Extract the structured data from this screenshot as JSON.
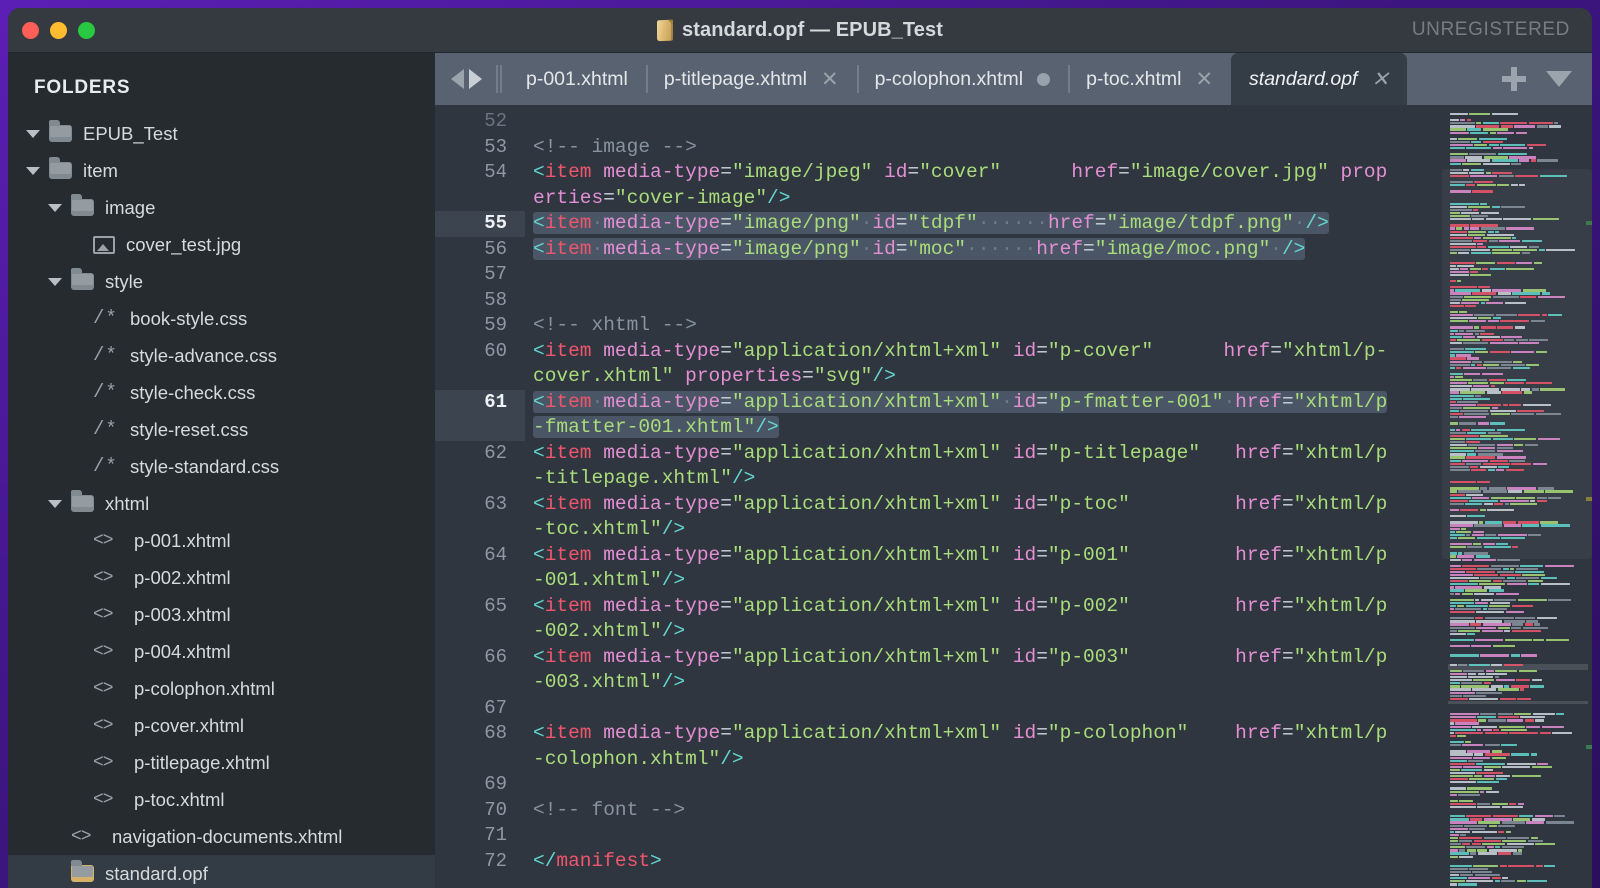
{
  "window": {
    "title": "standard.opf — EPUB_Test",
    "license_status": "UNREGISTERED",
    "doc_icon": "opf-file-icon"
  },
  "traffic_lights": [
    {
      "name": "close",
      "color": "#ff5f57"
    },
    {
      "name": "minimize",
      "color": "#febc2e"
    },
    {
      "name": "zoom",
      "color": "#28c840"
    }
  ],
  "sidebar": {
    "heading": "FOLDERS",
    "tree": [
      {
        "label": "EPUB_Test",
        "icon": "folder-icon",
        "indent": 0,
        "twisty": "open",
        "selected": false
      },
      {
        "label": "item",
        "icon": "folder-icon",
        "indent": 1,
        "twisty": "open",
        "selected": false
      },
      {
        "label": "image",
        "icon": "folder-icon",
        "indent": 2,
        "twisty": "open",
        "selected": false
      },
      {
        "label": "cover_test.jpg",
        "icon": "image-file-icon",
        "indent": 3,
        "twisty": "none",
        "selected": false
      },
      {
        "label": "style",
        "icon": "folder-icon",
        "indent": 2,
        "twisty": "open",
        "selected": false
      },
      {
        "label": "book-style.css",
        "icon": "css-file-icon",
        "indent": 3,
        "twisty": "none",
        "selected": false
      },
      {
        "label": "style-advance.css",
        "icon": "css-file-icon",
        "indent": 3,
        "twisty": "none",
        "selected": false
      },
      {
        "label": "style-check.css",
        "icon": "css-file-icon",
        "indent": 3,
        "twisty": "none",
        "selected": false
      },
      {
        "label": "style-reset.css",
        "icon": "css-file-icon",
        "indent": 3,
        "twisty": "none",
        "selected": false
      },
      {
        "label": "style-standard.css",
        "icon": "css-file-icon",
        "indent": 3,
        "twisty": "none",
        "selected": false
      },
      {
        "label": "xhtml",
        "icon": "folder-icon",
        "indent": 2,
        "twisty": "open",
        "selected": false
      },
      {
        "label": "p-001.xhtml",
        "icon": "code-file-icon",
        "indent": 3,
        "twisty": "none",
        "selected": false
      },
      {
        "label": "p-002.xhtml",
        "icon": "code-file-icon",
        "indent": 3,
        "twisty": "none",
        "selected": false
      },
      {
        "label": "p-003.xhtml",
        "icon": "code-file-icon",
        "indent": 3,
        "twisty": "none",
        "selected": false
      },
      {
        "label": "p-004.xhtml",
        "icon": "code-file-icon",
        "indent": 3,
        "twisty": "none",
        "selected": false
      },
      {
        "label": "p-colophon.xhtml",
        "icon": "code-file-icon",
        "indent": 3,
        "twisty": "none",
        "selected": false
      },
      {
        "label": "p-cover.xhtml",
        "icon": "code-file-icon",
        "indent": 3,
        "twisty": "none",
        "selected": false
      },
      {
        "label": "p-titlepage.xhtml",
        "icon": "code-file-icon",
        "indent": 3,
        "twisty": "none",
        "selected": false
      },
      {
        "label": "p-toc.xhtml",
        "icon": "code-file-icon",
        "indent": 3,
        "twisty": "none",
        "selected": false
      },
      {
        "label": "navigation-documents.xhtml",
        "icon": "code-file-icon",
        "indent": 2,
        "twisty": "none",
        "selected": false
      },
      {
        "label": "standard.opf",
        "icon": "opf-file-icon",
        "indent": 2,
        "twisty": "none",
        "selected": true
      }
    ]
  },
  "tabbar": {
    "nav_back": "nav-back-arrow",
    "nav_forward": "nav-forward-arrow",
    "new_tab_label": "+",
    "tab_menu_label": "▼",
    "tabs": [
      {
        "label": "p-001.xhtml",
        "active": false,
        "state": "none",
        "close": ""
      },
      {
        "label": "p-titlepage.xhtml",
        "active": false,
        "state": "close",
        "close": "✕"
      },
      {
        "label": "p-colophon.xhtml",
        "active": false,
        "state": "dirty",
        "close": ""
      },
      {
        "label": "p-toc.xhtml",
        "active": false,
        "state": "close",
        "close": "✕"
      },
      {
        "label": "standard.opf",
        "active": true,
        "state": "close",
        "close": "✕"
      }
    ]
  },
  "editor": {
    "first_visible_line": 52,
    "selected_lines": [
      55,
      56,
      61
    ],
    "caret_lines": [
      55,
      61
    ],
    "syntax_colors": {
      "bracket": "#63d6cf",
      "tag_name": "#f0556c",
      "attribute": "#e48fd4",
      "string": "#a9dc7a",
      "comment": "#8893a0",
      "foreground": "#cfd6de",
      "background": "#2f3640",
      "selection": "#4a5665",
      "gutter_text": "#8e98a4"
    },
    "lines": [
      {
        "n": 52,
        "text": "",
        "clipped": true
      },
      {
        "n": 53,
        "text": "<!-- image -->"
      },
      {
        "n": 54,
        "text": "<item media-type=\"image/jpeg\" id=\"cover\"      href=\"image/cover.jpg\" properties=\"cover-image\"/>"
      },
      {
        "n": 55,
        "text": "<item media-type=\"image/png\" id=\"tdpf\"      href=\"image/tdpf.png\" />"
      },
      {
        "n": 56,
        "text": "<item media-type=\"image/png\" id=\"moc\"      href=\"image/moc.png\" />"
      },
      {
        "n": 57,
        "text": ""
      },
      {
        "n": 58,
        "text": ""
      },
      {
        "n": 59,
        "text": "<!-- xhtml -->"
      },
      {
        "n": 60,
        "text": "<item media-type=\"application/xhtml+xml\" id=\"p-cover\"      href=\"xhtml/p-cover.xhtml\" properties=\"svg\"/>"
      },
      {
        "n": 61,
        "text": "<item media-type=\"application/xhtml+xml\" id=\"p-fmatter-001\" href=\"xhtml/p-fmatter-001.xhtml\"/>"
      },
      {
        "n": 62,
        "text": "<item media-type=\"application/xhtml+xml\" id=\"p-titlepage\"   href=\"xhtml/p-titlepage.xhtml\"/>"
      },
      {
        "n": 63,
        "text": "<item media-type=\"application/xhtml+xml\" id=\"p-toc\"         href=\"xhtml/p-toc.xhtml\"/>"
      },
      {
        "n": 64,
        "text": "<item media-type=\"application/xhtml+xml\" id=\"p-001\"         href=\"xhtml/p-001.xhtml\"/>"
      },
      {
        "n": 65,
        "text": "<item media-type=\"application/xhtml+xml\" id=\"p-002\"         href=\"xhtml/p-002.xhtml\"/>"
      },
      {
        "n": 66,
        "text": "<item media-type=\"application/xhtml+xml\" id=\"p-003\"         href=\"xhtml/p-003.xhtml\"/>"
      },
      {
        "n": 67,
        "text": ""
      },
      {
        "n": 68,
        "text": "<item media-type=\"application/xhtml+xml\" id=\"p-colophon\"    href=\"xhtml/p-colophon.xhtml\"/>"
      },
      {
        "n": 69,
        "text": ""
      },
      {
        "n": 70,
        "text": "<!-- font -->"
      },
      {
        "n": 71,
        "text": ""
      },
      {
        "n": 72,
        "text": "</manifest>"
      }
    ]
  },
  "minimap": {
    "name": "code-minimap",
    "viewport_visible": true
  }
}
